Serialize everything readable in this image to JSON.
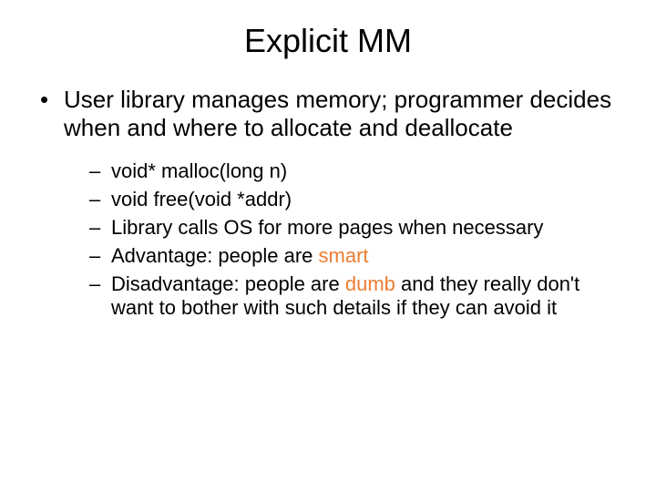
{
  "title": "Explicit MM",
  "bullet1": "User library manages memory; programmer decides when and where to allocate and deallocate",
  "sub": {
    "s1": "void* malloc(long n)",
    "s2": "void free(void *addr)",
    "s3": "Library calls OS for more pages when necessary",
    "s4_pre": "Advantage: people are ",
    "s4_accent": "smart",
    "s5_pre": "Disadvantage: people are ",
    "s5_accent": "dumb",
    "s5_post": " and they really don't want to bother with such details if they can avoid it"
  },
  "accent_color": "#ed7d31"
}
